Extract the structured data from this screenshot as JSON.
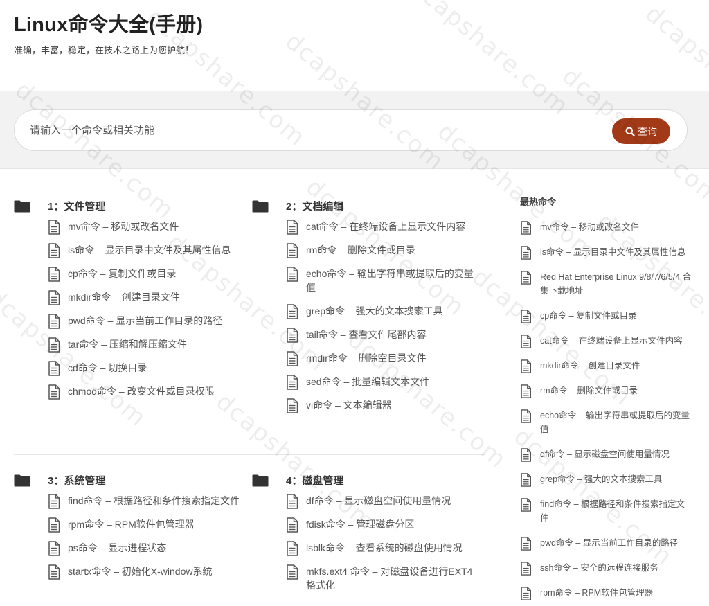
{
  "site": {
    "title": "Linux命令大全(手册)",
    "subtitle": "准确，丰富，稳定，在技术之路上为您护航！"
  },
  "search": {
    "placeholder": "请输入一个命令或相关功能",
    "button_label": "查询",
    "button_color": "#a33a17"
  },
  "categories": [
    {
      "title": "1：文件管理",
      "items": [
        "mv命令 – 移动或改名文件",
        "ls命令 – 显示目录中文件及其属性信息",
        "cp命令 – 复制文件或目录",
        "mkdir命令 – 创建目录文件",
        "pwd命令 – 显示当前工作目录的路径",
        "tar命令 – 压缩和解压缩文件",
        "cd命令 – 切换目录",
        "chmod命令 – 改变文件或目录权限"
      ]
    },
    {
      "title": "2：文档编辑",
      "items": [
        "cat命令 – 在终端设备上显示文件内容",
        "rm命令 – 删除文件或目录",
        "echo命令 – 输出字符串或提取后的变量值",
        "grep命令 – 强大的文本搜索工具",
        "tail命令 – 查看文件尾部内容",
        "rmdir命令 – 删除空目录文件",
        "sed命令 – 批量编辑文本文件",
        "vi命令 – 文本编辑器"
      ]
    },
    {
      "title": "3：系统管理",
      "items": [
        "find命令 – 根据路径和条件搜索指定文件",
        "rpm命令 – RPM软件包管理器",
        "ps命令 – 显示进程状态",
        "startx命令 – 初始化X-window系统"
      ]
    },
    {
      "title": "4：磁盘管理",
      "items": [
        "df命令 – 显示磁盘空间使用量情况",
        "fdisk命令 – 管理磁盘分区",
        "lsblk命令 – 查看系统的磁盘使用情况",
        "mkfs.ext4 命令 – 对磁盘设备进行EXT4格式化"
      ]
    }
  ],
  "sidebar": {
    "title": "最热命令",
    "items": [
      "mv命令 – 移动或改名文件",
      "ls命令 – 显示目录中文件及其属性信息",
      "Red Hat Enterprise Linux 9/8/7/6/5/4 合集下载地址",
      "cp命令 – 复制文件或目录",
      "cat命令 – 在终端设备上显示文件内容",
      "mkdir命令 – 创建目录文件",
      "rm命令 – 删除文件或目录",
      "echo命令 – 输出字符串或提取后的变量值",
      "df命令 – 显示磁盘空间使用量情况",
      "grep命令 – 强大的文本搜索工具",
      "find命令 – 根据路径和条件搜索指定文件",
      "pwd命令 – 显示当前工作目录的路径",
      "ssh命令 – 安全的远程连接服务",
      "rpm命令 – RPM软件包管理器"
    ]
  },
  "watermark": "dcapshare.com",
  "icons": {
    "category": "folder-icon",
    "item": "document-icon",
    "search": "search-icon"
  }
}
